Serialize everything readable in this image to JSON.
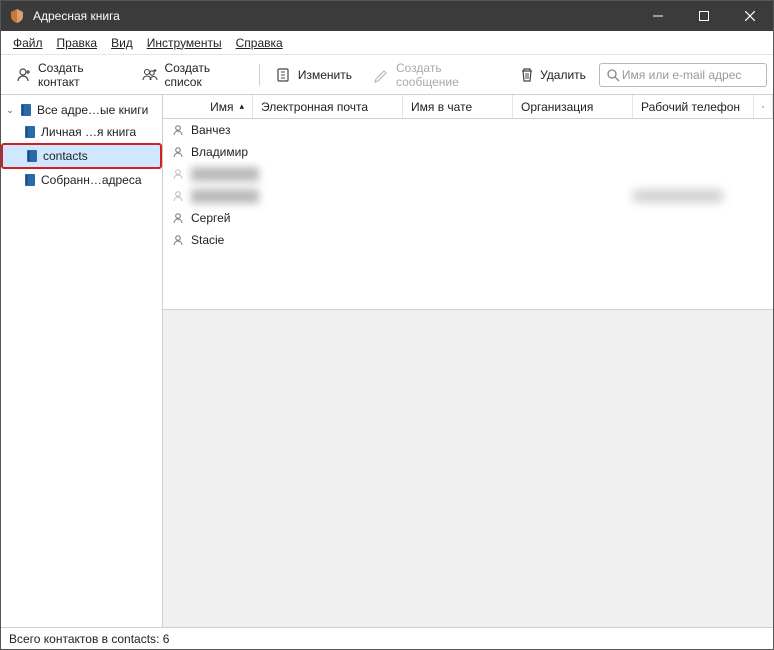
{
  "window": {
    "title": "Адресная книга"
  },
  "menubar": {
    "file": "Файл",
    "edit": "Правка",
    "view": "Вид",
    "tools": "Инструменты",
    "help": "Справка"
  },
  "toolbar": {
    "new_contact": "Создать контакт",
    "new_list": "Создать список",
    "edit": "Изменить",
    "compose": "Создать сообщение",
    "delete": "Удалить"
  },
  "search": {
    "placeholder": "Имя или e-mail адрес"
  },
  "sidebar": {
    "root": "Все адре…ые книги",
    "items": [
      {
        "label": "Личная …я книга"
      },
      {
        "label": "contacts"
      },
      {
        "label": "Собранн…адреса"
      }
    ]
  },
  "columns": {
    "name": "Имя",
    "email": "Электронная почта",
    "chat": "Имя в чате",
    "org": "Организация",
    "phone": "Рабочий телефон"
  },
  "contacts": [
    {
      "name": "Ванчез",
      "blurred": false
    },
    {
      "name": "Владимир",
      "blurred": false
    },
    {
      "name": "████████",
      "blurred": true
    },
    {
      "name": "████████",
      "blurred": true,
      "phone_blurred": true
    },
    {
      "name": "Сергей",
      "blurred": false
    },
    {
      "name": "Stacie",
      "blurred": false
    }
  ],
  "status": {
    "text": "Всего контактов в contacts: 6"
  }
}
